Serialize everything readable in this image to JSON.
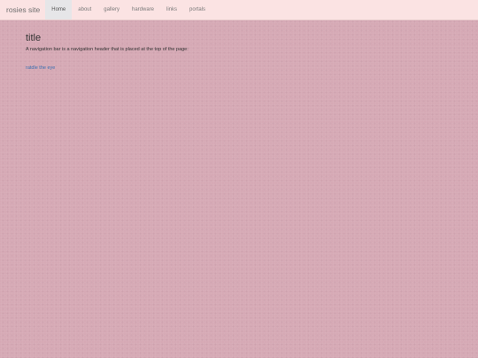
{
  "navbar": {
    "brand": "rosies site",
    "items": [
      {
        "label": "Home",
        "active": true
      },
      {
        "label": "about"
      },
      {
        "label": "gallery"
      },
      {
        "label": "hardware"
      },
      {
        "label": "links"
      },
      {
        "label": "portals"
      }
    ]
  },
  "main": {
    "title": "title",
    "description": "A navigation bar is a navigation header that is placed at the top of the page:",
    "link_text": "ratdle the eye"
  },
  "colors": {
    "background": "#d6a9b5",
    "navbar_bg": "#fbe3e3",
    "active_tab_bg": "#e6e6e8",
    "link": "#3a6fb0"
  }
}
